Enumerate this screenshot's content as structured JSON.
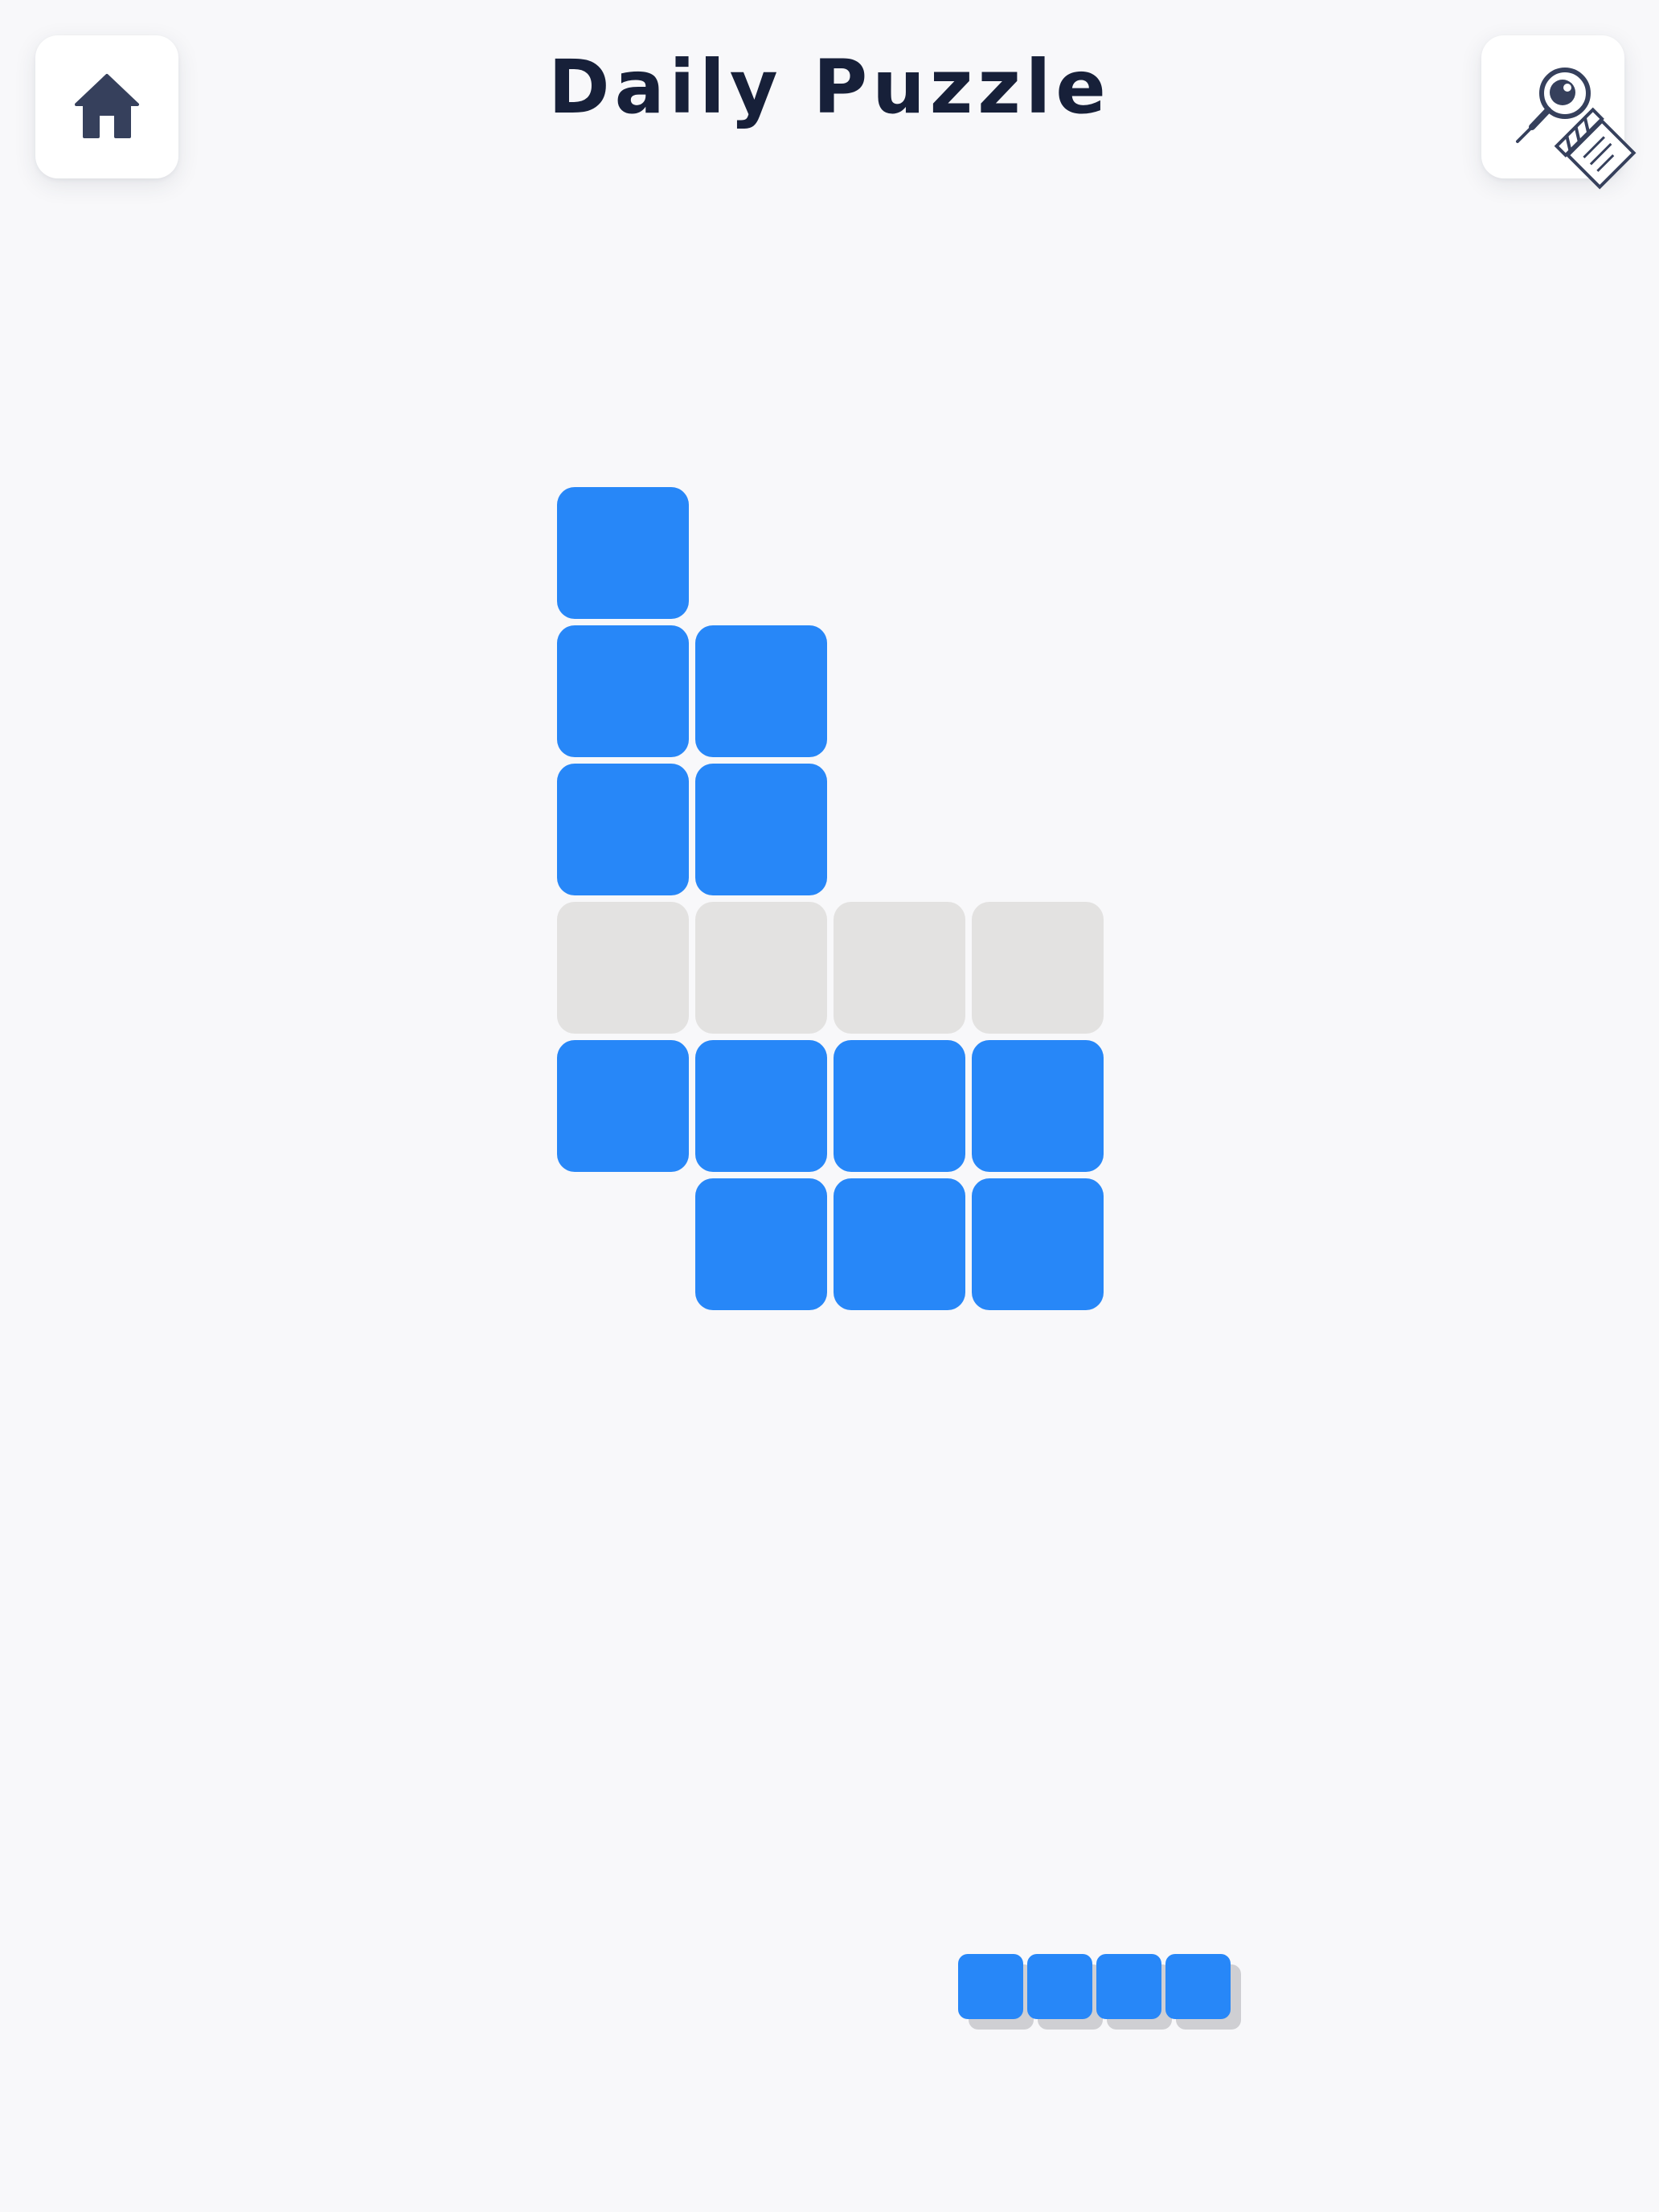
{
  "header": {
    "title": "Daily Puzzle",
    "home_icon": "home-icon",
    "hint_icon": "magnifier-clapperboard-icon"
  },
  "colors": {
    "background": "#f8f8fa",
    "filled": "#2787f8",
    "empty": "#e3e2e1",
    "title": "#172039",
    "icon": "#36405c"
  },
  "board": {
    "rows": 6,
    "cols": 4,
    "cells": [
      [
        "filled",
        null,
        null,
        null
      ],
      [
        "filled",
        "filled",
        null,
        null
      ],
      [
        "filled",
        "filled",
        null,
        null
      ],
      [
        "empty",
        "empty",
        "empty",
        "empty"
      ],
      [
        "filled",
        "filled",
        "filled",
        "filled"
      ],
      [
        null,
        "filled",
        "filled",
        "filled"
      ]
    ]
  },
  "tray": {
    "piece": {
      "shape": "1x4 horizontal",
      "cells": 4
    }
  }
}
